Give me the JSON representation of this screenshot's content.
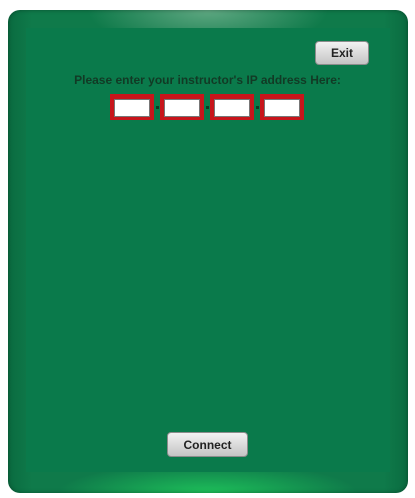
{
  "dialog": {
    "exit_label": "Exit",
    "prompt": "Please enter your instructor's IP address Here:",
    "ip_octets": [
      "",
      "",
      "",
      ""
    ],
    "connect_label": "Connect"
  },
  "colors": {
    "background_green": "#0a7a4b",
    "field_border_red": "#c8151b",
    "button_gray": "#d9d9d9"
  }
}
